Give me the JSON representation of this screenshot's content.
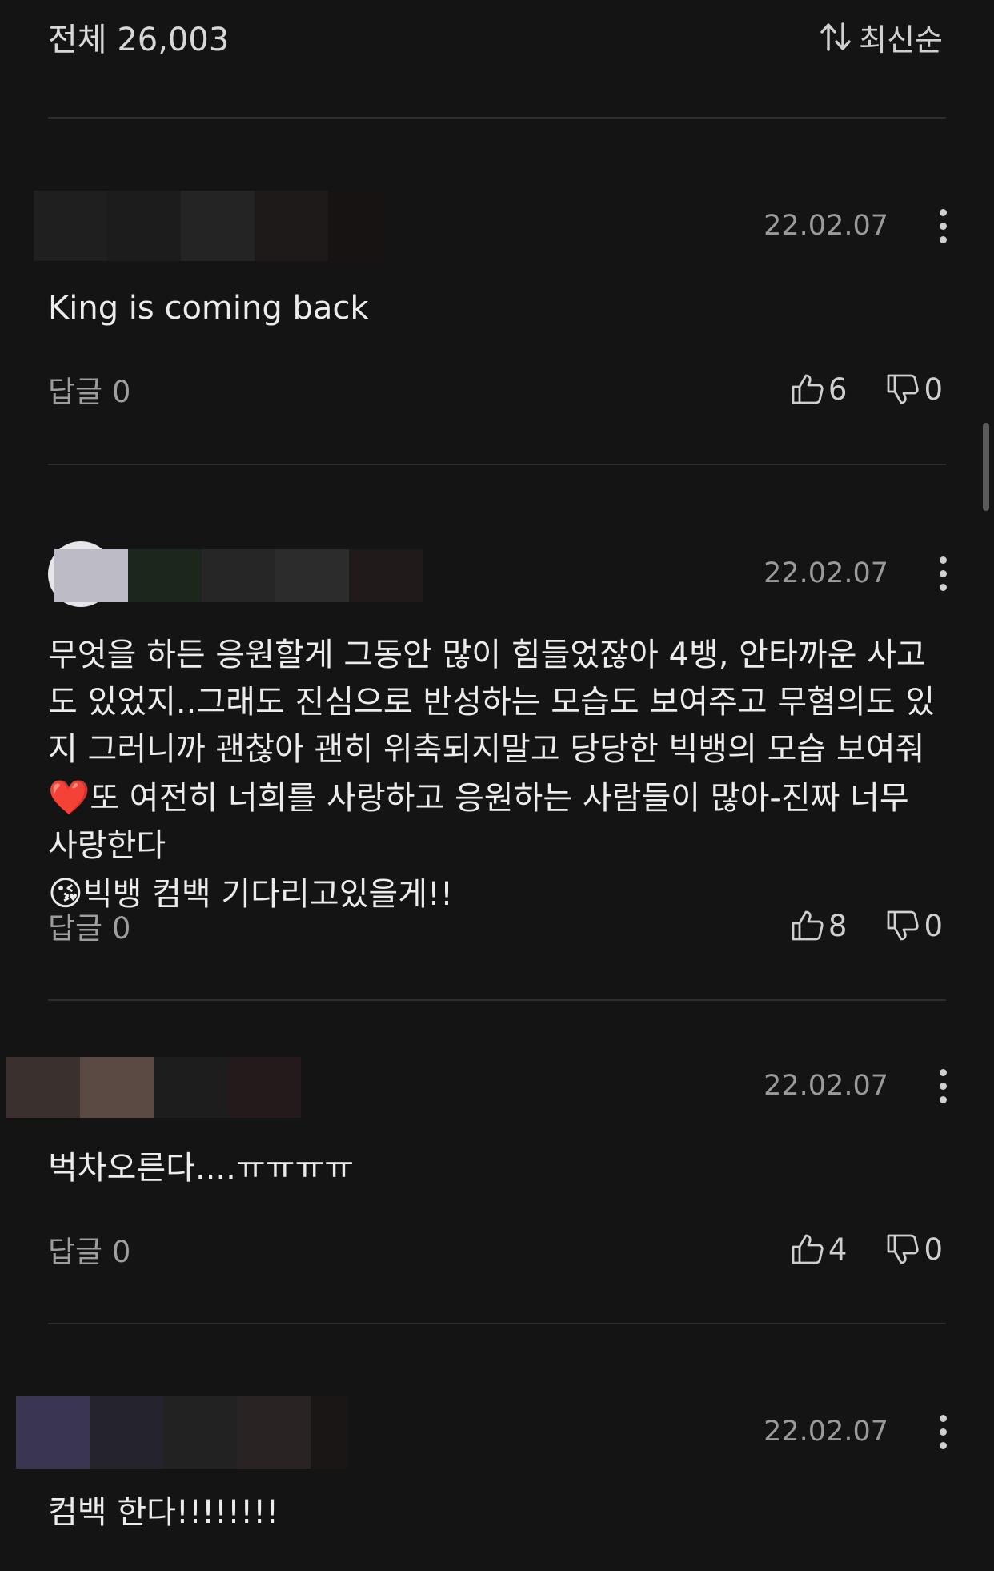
{
  "header": {
    "total_label": "전체 26,003",
    "sort_label": "최신순"
  },
  "comments": [
    {
      "date": "22.02.07",
      "text": "King is coming back",
      "reply_label": "답글 0",
      "likes": "6",
      "dislikes": "0"
    },
    {
      "date": "22.02.07",
      "text_part1": "무엇을 하든 응원할게 그동안 많이 힘들었잖아 4뱅, 안타까운 사고도 있었지..그래도 진심으로 반성하는 모습도 보여주고 무혐의도 있지 그러니까 괜찮아 괜히 위축되지말고 당당한 빅뱅의 모습 보여줘",
      "emoji1": "❤️",
      "text_part2": "또 여전히 너희를 사랑하고 응원하는 사람들이 많아-진짜 너무 사랑한다",
      "emoji2": "😘",
      "text_part3": "빅뱅 컴백 기다리고있을게!!",
      "reply_label": "답글 0",
      "likes": "8",
      "dislikes": "0"
    },
    {
      "date": "22.02.07",
      "text": "벅차오른다....ㅠㅠㅠㅠ",
      "reply_label": "답글 0",
      "likes": "4",
      "dislikes": "0"
    },
    {
      "date": "22.02.07",
      "text": "컴백 한다!!!!!!!!"
    }
  ],
  "icons": {
    "sort": "sort-arrows-icon",
    "like": "thumbs-up-icon",
    "dislike": "thumbs-down-icon",
    "more": "more-vertical-icon"
  },
  "colors": {
    "background": "#141414",
    "divider": "#2e2e2e",
    "text": "#ececec",
    "muted": "#9a9a9a"
  }
}
